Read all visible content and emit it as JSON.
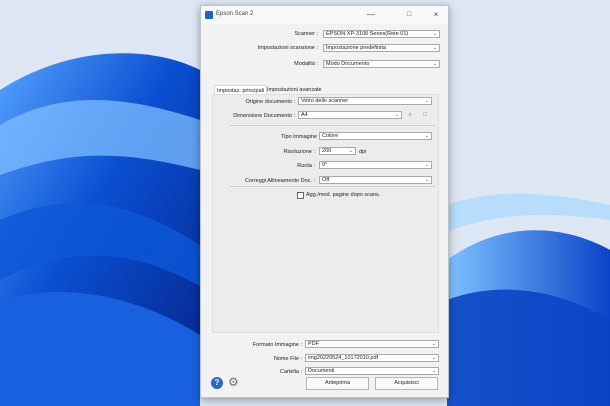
{
  "window": {
    "title": "Epson Scan 2",
    "close_glyph": "×",
    "minimize_glyph": "—",
    "maximize_glyph": "□"
  },
  "top": {
    "scanner_label": "Scanner :",
    "scanner_value": "EPSON XP-3100 Series(Rete 01)",
    "settings_label": "Impostazioni scansione :",
    "settings_value": "Impostazione predefinita",
    "mode_label": "Modalità :",
    "mode_value": "Modo Documento"
  },
  "tabs": [
    {
      "label": "Impostaz. principali"
    },
    {
      "label": "Impostazioni avanzate"
    }
  ],
  "main": {
    "origin_label": "Origine documento :",
    "origin_value": "Vetro dello scanner",
    "size_label": "Dimensione Documento :",
    "size_value": "A4",
    "image_type_label": "Tipo immagine :",
    "image_type_value": "Colore",
    "resolution_label": "Risoluzione :",
    "resolution_value": "200",
    "resolution_unit": "dpi",
    "rotate_label": "Ruota :",
    "rotate_value": "0°",
    "skew_label": "Correggi Allineamento Doc. :",
    "skew_value": "Off",
    "add_edit_label": "Agg./mod. pagine dopo scans."
  },
  "bottom": {
    "format_label": "Formato Immagine :",
    "format_value": "PDF",
    "filename_label": "Nome File :",
    "filename_value": "img20220524_10172010.pdf",
    "folder_label": "Cartella :",
    "folder_value": "Documenti",
    "preview_button": "Anteprima",
    "scan_button": "Acquisisci"
  },
  "icons": {
    "help": "?",
    "settings": "⚙",
    "chevron": "⌄"
  },
  "colors": {
    "accent": "#2f67c8",
    "desktop_bg": "#dfe8f4",
    "window_bg": "#f2f2f2"
  }
}
